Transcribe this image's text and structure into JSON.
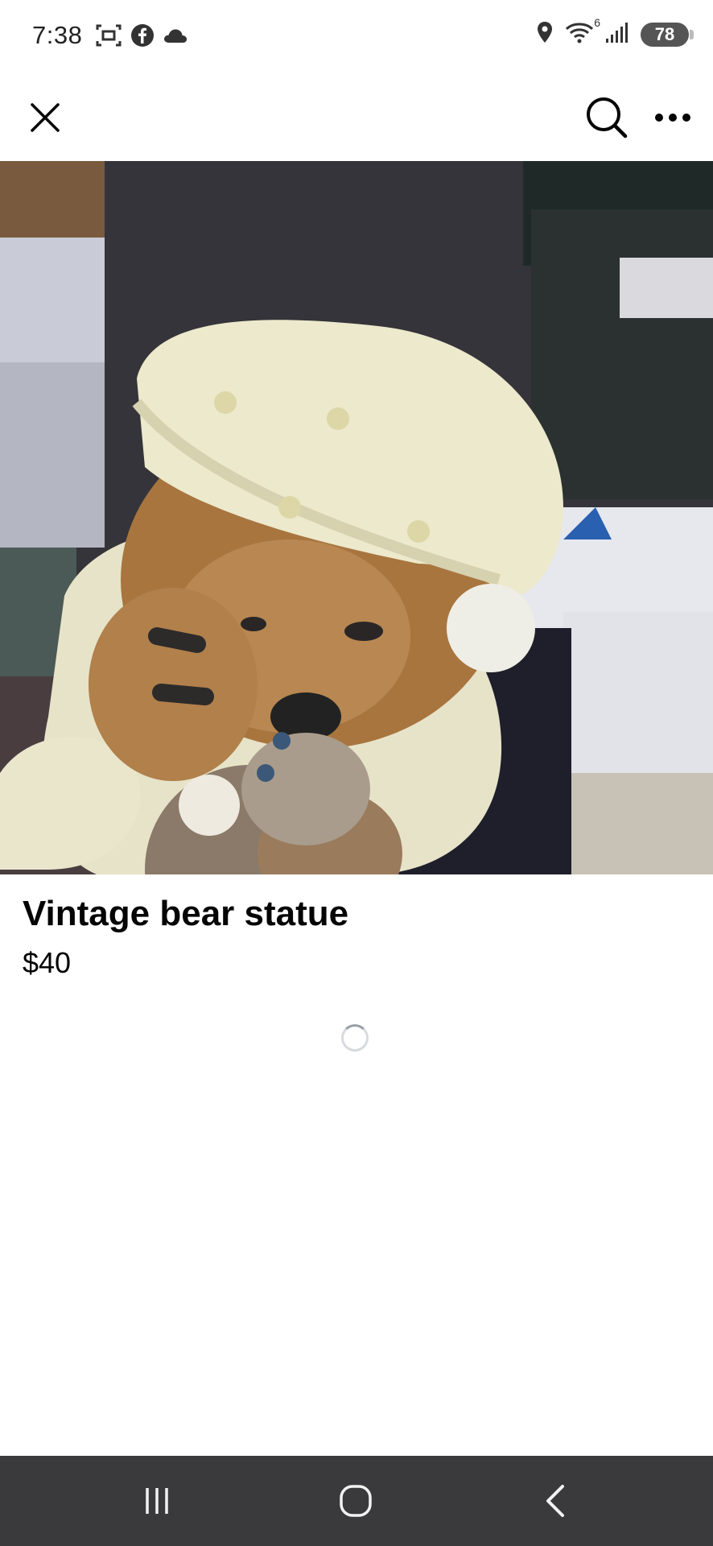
{
  "status_bar": {
    "time": "7:38",
    "left_icons": [
      "screenshot-icon",
      "facebook-icon",
      "cloud-icon"
    ],
    "right_icons": [
      "location-icon",
      "wifi-icon",
      "signal-icon"
    ],
    "wifi_label": "6",
    "battery_level": "78"
  },
  "top_bar": {
    "icons": [
      "close-icon",
      "search-icon",
      "more-icon"
    ]
  },
  "listing": {
    "title": "Vintage bear statue",
    "price": "$40"
  },
  "nav_bar": {
    "icons": [
      "recents-icon",
      "home-icon",
      "back-icon"
    ]
  },
  "colors": {
    "background": "#ffffff",
    "text": "#050505",
    "nav_bar": "#3a3a3c",
    "battery": "#555555"
  }
}
